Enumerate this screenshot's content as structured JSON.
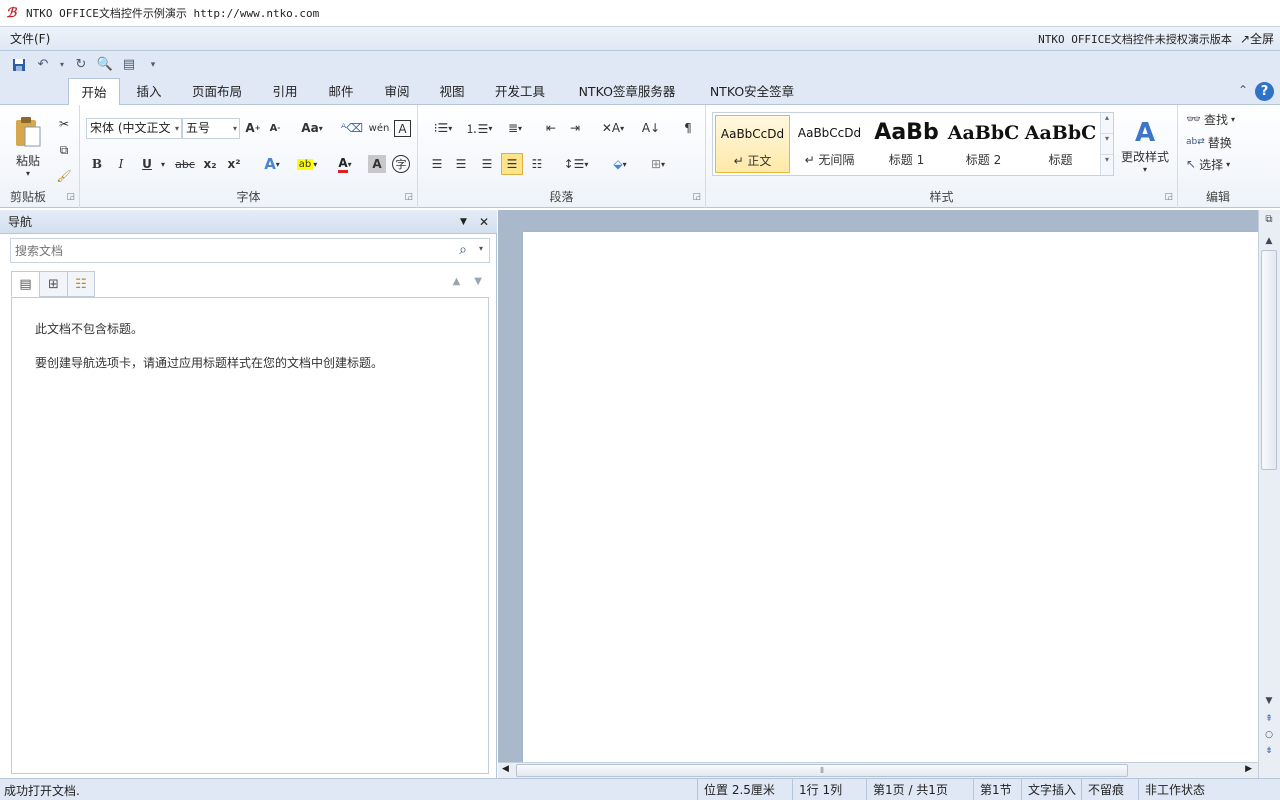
{
  "window": {
    "title": "NTKO OFFICE文档控件示例演示 http://www.ntko.com"
  },
  "menubar": {
    "file_menu": "文件(F)",
    "notice": "NTKO OFFICE文档控件未授权演示版本",
    "fullscreen": "↗全屏"
  },
  "ribbon_tabs": [
    "开始",
    "插入",
    "页面布局",
    "引用",
    "邮件",
    "审阅",
    "视图",
    "开发工具",
    "NTKO签章服务器",
    "NTKO安全签章"
  ],
  "clipboard": {
    "paste": "粘贴",
    "label": "剪贴板"
  },
  "font": {
    "name": "宋体 (中文正文",
    "size": "五号",
    "label": "字体",
    "change_case": "Aa",
    "bold": "B",
    "italic": "I",
    "underline": "U",
    "strike": "abc",
    "subscript": "x₂",
    "superscript": "x²"
  },
  "paragraph": {
    "label": "段落"
  },
  "styles": {
    "label": "样式",
    "items": [
      {
        "preview": "AaBbCcDd",
        "name": "↵ 正文"
      },
      {
        "preview": "AaBbCcDd",
        "name": "↵ 无间隔"
      },
      {
        "preview": "AaBb",
        "name": "标题 1"
      },
      {
        "preview": "AaBbC",
        "name": "标题 2"
      },
      {
        "preview": "AaBbC",
        "name": "标题"
      }
    ],
    "change_styles": "更改样式"
  },
  "editing": {
    "label": "编辑",
    "find": "查找",
    "replace": "替换",
    "select": "选择"
  },
  "nav": {
    "title": "导航",
    "search_placeholder": "搜索文档",
    "no_headings": "此文档不包含标题。",
    "hint": "要创建导航选项卡，请通过应用标题样式在您的文档中创建标题。"
  },
  "status": {
    "message": "成功打开文档.",
    "position": "位置 2.5厘米",
    "row_col": "1行 1列",
    "page": "第1页 / 共1页",
    "section": "第1节",
    "insert_mode": "文字插入",
    "track": "不留痕",
    "work_state": "非工作状态"
  }
}
